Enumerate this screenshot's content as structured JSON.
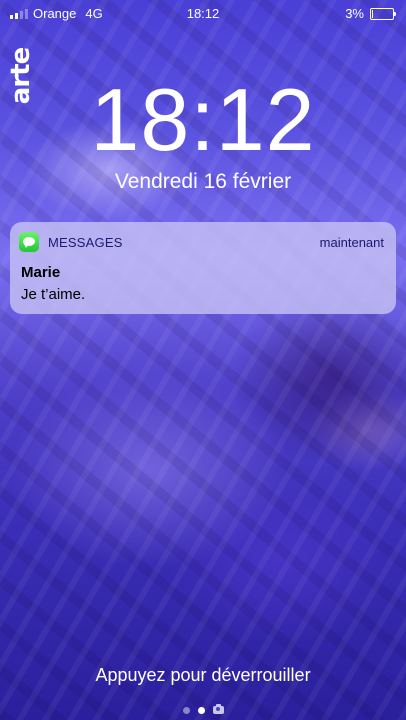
{
  "status_bar": {
    "carrier": "Orange",
    "network": "4G",
    "time": "18:12",
    "battery_percent": "3%",
    "battery_level": 0.03
  },
  "watermark": {
    "logo": "arte"
  },
  "lock_screen": {
    "clock": "18:12",
    "date": "Vendredi 16 février",
    "unlock_hint": "Appuyez pour déverrouiller",
    "page_count": 3,
    "active_page": 1
  },
  "notification": {
    "app_name": "MESSAGES",
    "app_icon": "messages-icon",
    "timestamp": "maintenant",
    "sender": "Marie",
    "message": "Je t’aime."
  },
  "colors": {
    "wallpaper_tint": "#5b52e0",
    "notification_bg": "#c8c3f5",
    "accent_text": "#1a1a6e",
    "messages_green": "#22c734"
  }
}
